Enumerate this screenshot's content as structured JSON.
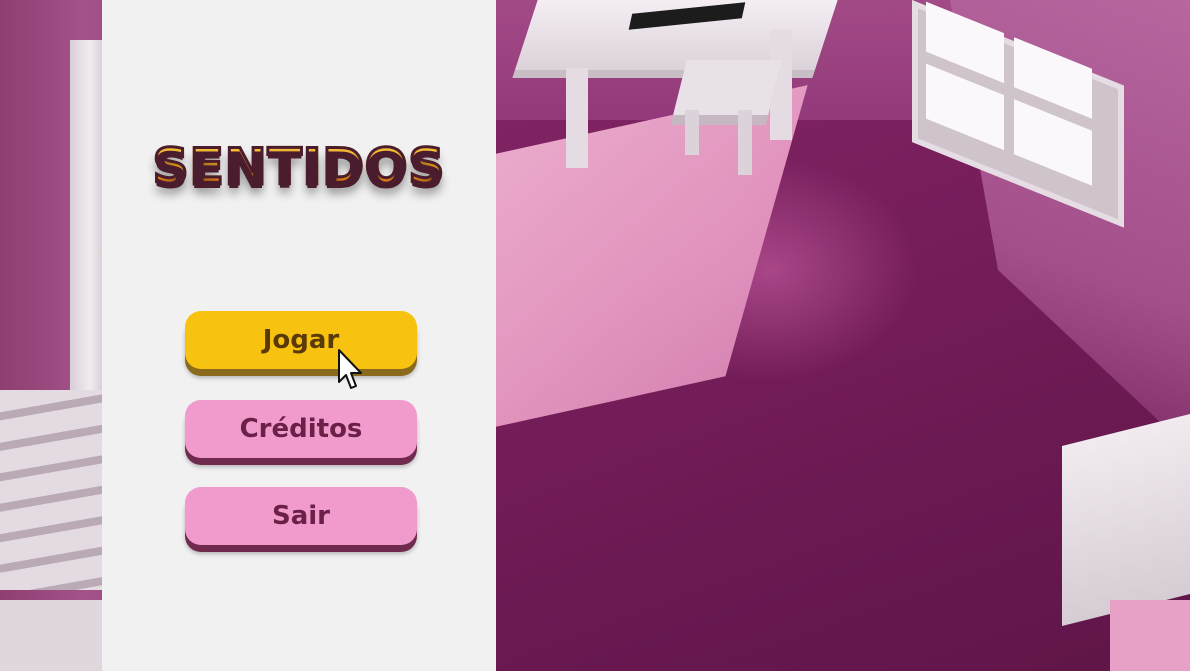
{
  "menu": {
    "logo_text": "SENTIDOS",
    "buttons": {
      "play": "Jogar",
      "credits": "Créditos",
      "exit": "Sair"
    }
  },
  "colors": {
    "panel": "#f1f1f1",
    "play_button": "#f7c310",
    "secondary_button": "#f19bcd",
    "button_text": "#6b2047",
    "room": "#7d2160"
  },
  "icons": {
    "cursor": "arrow-pointer-icon"
  }
}
